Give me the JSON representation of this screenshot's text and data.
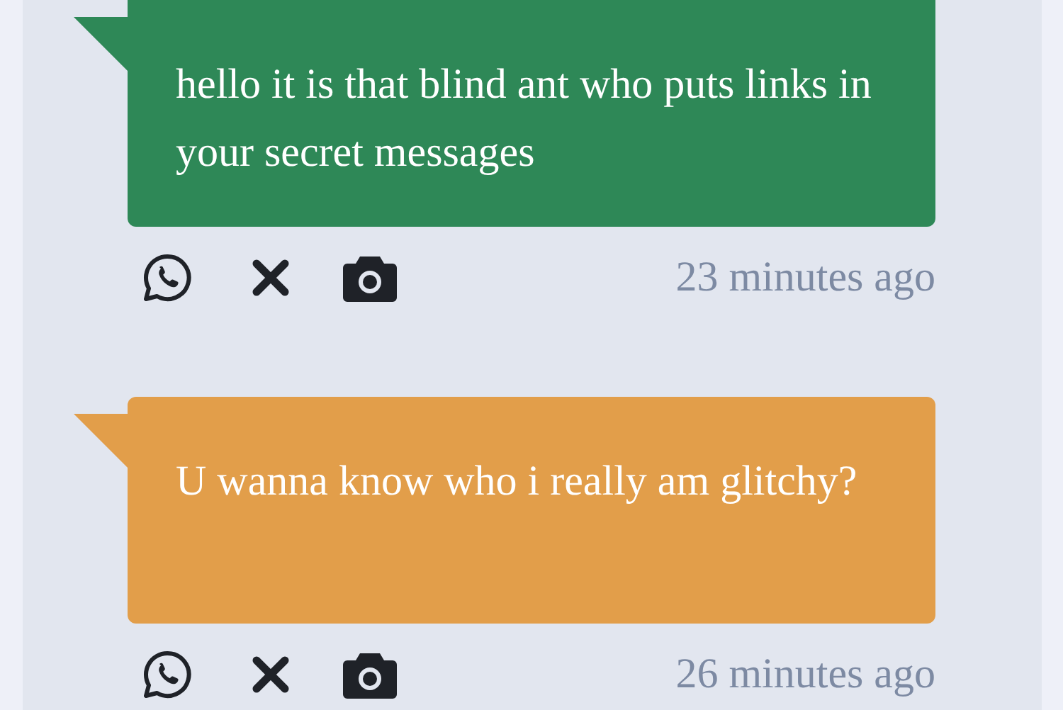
{
  "messages": [
    {
      "text": "hello it is that blind ant who puts links in your secret messages",
      "color": "#2e8857",
      "time": "23 minutes ago"
    },
    {
      "text": "U wanna know who i really am glitchy?",
      "color": "#e29e4a",
      "time": "26 minutes ago"
    }
  ]
}
